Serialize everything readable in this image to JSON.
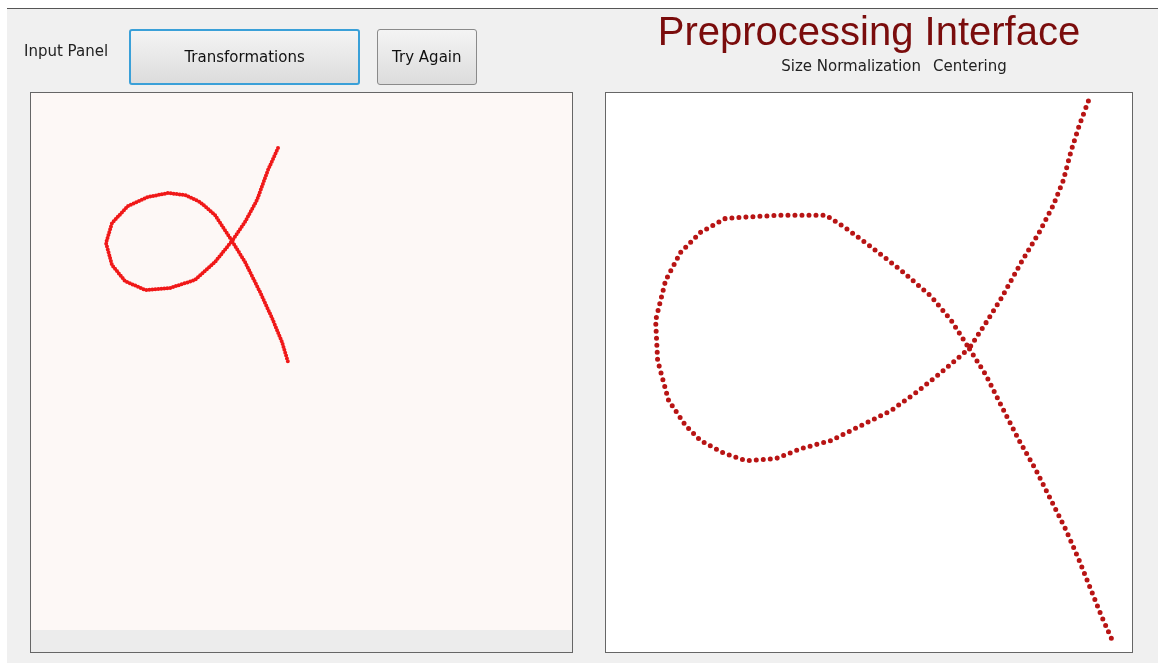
{
  "input_label": "Input Panel",
  "buttons": [
    {
      "label": "Transformations",
      "focused": true
    },
    {
      "label": "Try Again",
      "focused": false
    }
  ],
  "title": "Preprocessing Interface",
  "steps": [
    "Size Normalization",
    "Centering"
  ]
}
